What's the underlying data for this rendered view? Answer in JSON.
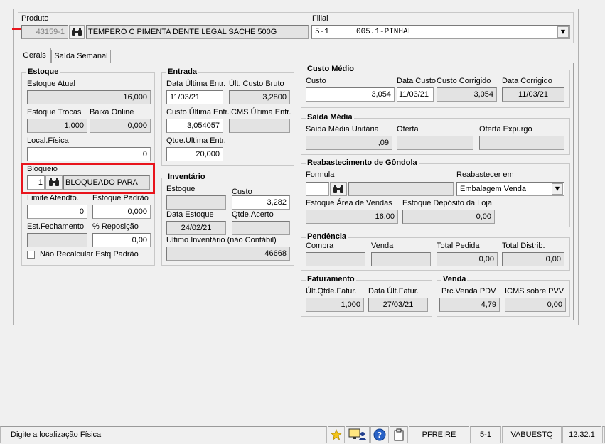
{
  "produto": {
    "label": "Produto",
    "code": "43159-1",
    "name": "TEMPERO C PIMENTA DENTE LEGAL SACHE 500G"
  },
  "filial": {
    "label": "Filial",
    "code": "5-1",
    "name": "005.1-PINHAL"
  },
  "tabs": [
    {
      "label": "Gerais"
    },
    {
      "label": "Saída Semanal"
    }
  ],
  "estoque": {
    "title": "Estoque",
    "atual_label": "Estoque Atual",
    "atual": "16,000",
    "trocas_label": "Estoque Trocas",
    "trocas": "1,000",
    "baixa_label": "Baixa Online",
    "baixa": "0,000",
    "local_label": "Local.Física",
    "local": "0",
    "bloqueio_label": "Bloqueio",
    "bloqueio_code": "1",
    "bloqueio_text": "BLOQUEADO PARA",
    "limite_label": "Limite Atendto.",
    "limite": "0",
    "padrao_label": "Estoque Padrão",
    "padrao": "0,000",
    "fechamento_label": "Est.Fechamento",
    "fechamento": "",
    "reposicao_label": "% Reposição",
    "reposicao": "0,00",
    "nao_recalcular_label": "Não Recalcular Estq Padrão"
  },
  "entrada": {
    "title": "Entrada",
    "data_label": "Data Última Entr.",
    "data": "11/03/21",
    "ult_custo_label": "Últ. Custo Bruto",
    "ult_custo": "3,2800",
    "custo_label": "Custo Última Entr.",
    "custo": "3,054057",
    "icms_label": "ICMS Última Entr.",
    "icms": "",
    "qtde_label": "Qtde.Última Entr.",
    "qtde": "20,000"
  },
  "inventario": {
    "title": "Inventário",
    "estoque_label": "Estoque",
    "estoque": "",
    "custo_label": "Custo",
    "custo": "3,282",
    "data_label": "Data Estoque",
    "data": "24/02/21",
    "acerto_label": "Qtde.Acerto",
    "acerto": "",
    "ultimo_label": "Ultimo Inventário (não Contábil)",
    "ultimo": "46668"
  },
  "custo_medio": {
    "title": "Custo Médio",
    "custo_label": "Custo",
    "custo": "3,054",
    "data_label": "Data Custo",
    "data": "11/03/21",
    "corrigido_label": "Custo Corrigido",
    "corrigido": "3,054",
    "data_corrigido_label": "Data Corrigido",
    "data_corrigido": "11/03/21"
  },
  "saida_media": {
    "title": "Saída Média",
    "unitaria_label": "Saída Média Unitária",
    "unitaria": ",09",
    "oferta_label": "Oferta",
    "oferta": "",
    "expurgo_label": "Oferta Expurgo",
    "expurgo": ""
  },
  "reabastecimento": {
    "title": "Reabastecimento de Gôndola",
    "formula_label": "Formula",
    "formula": "",
    "formula_desc": "",
    "reabastecer_label": "Reabastecer em",
    "reabastecer": "Embalagem Venda",
    "area_label": "Estoque Área de Vendas",
    "area": "16,00",
    "deposito_label": "Estoque Depósito da Loja",
    "deposito": "0,00"
  },
  "pendencia": {
    "title": "Pendência",
    "compra_label": "Compra",
    "compra": "",
    "venda_label": "Venda",
    "venda": "",
    "total_pedida_label": "Total Pedida",
    "total_pedida": "0,00",
    "total_distrib_label": "Total  Distrib.",
    "total_distrib": "0,00"
  },
  "faturamento": {
    "title": "Faturamento",
    "qtde_label": "Últ.Qtde.Fatur.",
    "qtde": "1,000",
    "data_label": "Data Últ.Fatur.",
    "data": "27/03/21"
  },
  "venda": {
    "title": "Venda",
    "preco_label": "Prc.Venda PDV",
    "preco": "4,79",
    "icms_label": "ICMS sobre PVV",
    "icms": "0,00"
  },
  "statusbar": {
    "message": "Digite a localização Física",
    "user": "PFREIRE",
    "filial": "5-1",
    "db": "VABUESTQ",
    "version": "12.32.1"
  },
  "colors": {
    "highlight_border": "#e8141c",
    "arrow": "#e8141c"
  }
}
